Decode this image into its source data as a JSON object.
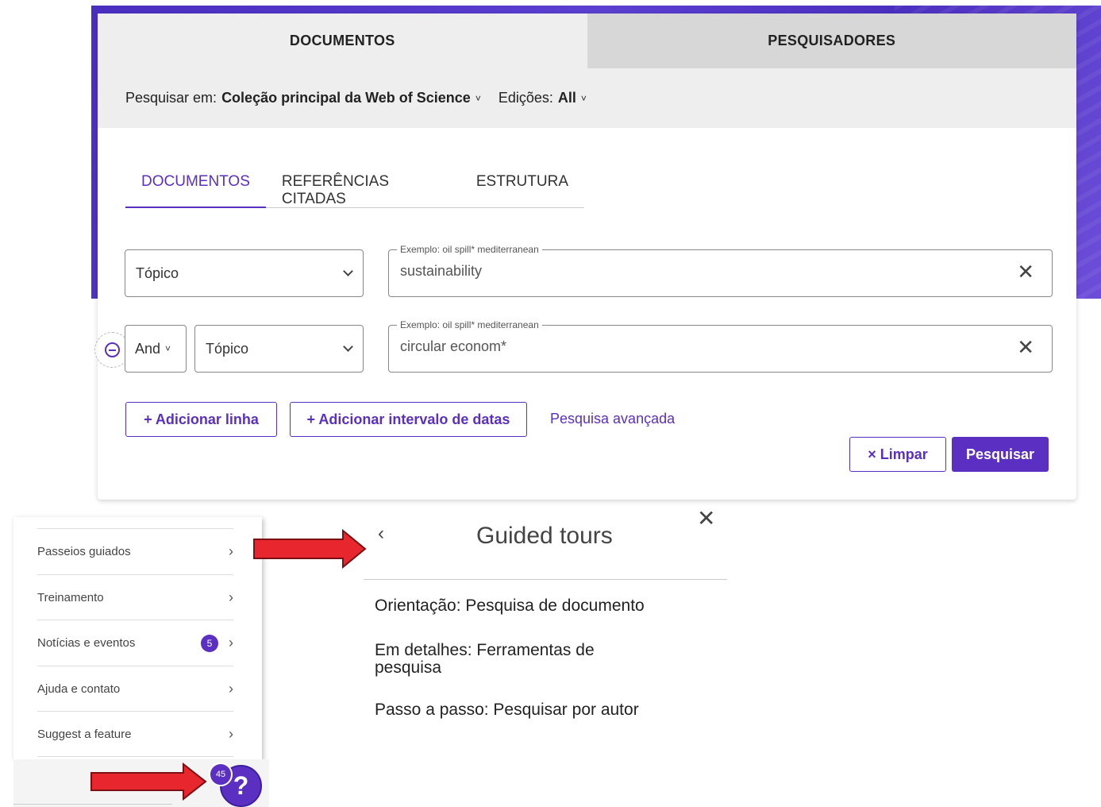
{
  "top_tabs": {
    "documents": "DOCUMENTOS",
    "researchers": "PESQUISADORES"
  },
  "collection": {
    "search_in_label": "Pesquisar em:",
    "search_in_value": "Coleção principal da Web of Science",
    "editions_label": "Edições:",
    "editions_value": "All"
  },
  "sub_tabs": [
    "DOCUMENTOS",
    "REFERÊNCIAS CITADAS",
    "ESTRUTURA"
  ],
  "rows": [
    {
      "field": "Tópico",
      "legend": "Exemplo: oil spill* mediterranean",
      "value": "sustainability"
    },
    {
      "operator": "And",
      "field": "Tópico",
      "legend": "Exemplo: oil spill* mediterranean",
      "value": "circular econom*"
    }
  ],
  "actions": {
    "add_row": "+ Adicionar linha",
    "add_date_range": "+ Adicionar intervalo de datas",
    "advanced": "Pesquisa avançada",
    "clear": "× Limpar",
    "search": "Pesquisar"
  },
  "help_menu": {
    "items": [
      {
        "label": "Passeios guiados"
      },
      {
        "label": "Treinamento"
      },
      {
        "label": "Notícias e eventos",
        "badge": "5"
      },
      {
        "label": "Ajuda e contato"
      },
      {
        "label": "Suggest a feature"
      }
    ],
    "fab_count": "45",
    "fab_label": "?"
  },
  "tour": {
    "title": "Guided tours",
    "items": [
      "Orientação: Pesquisa de documento",
      "Em detalhes: Ferramentas de pesquisa",
      "Passo a passo: Pesquisar por autor"
    ]
  },
  "colors": {
    "accent": "#5a2fc2",
    "hero": "#4a2ec0",
    "annotation_arrow": "#e8262e"
  },
  "icons": {
    "chevron": "chevron-down-icon",
    "clear": "close-icon",
    "back": "chevron-left-icon",
    "remove": "minus-circle-icon"
  }
}
